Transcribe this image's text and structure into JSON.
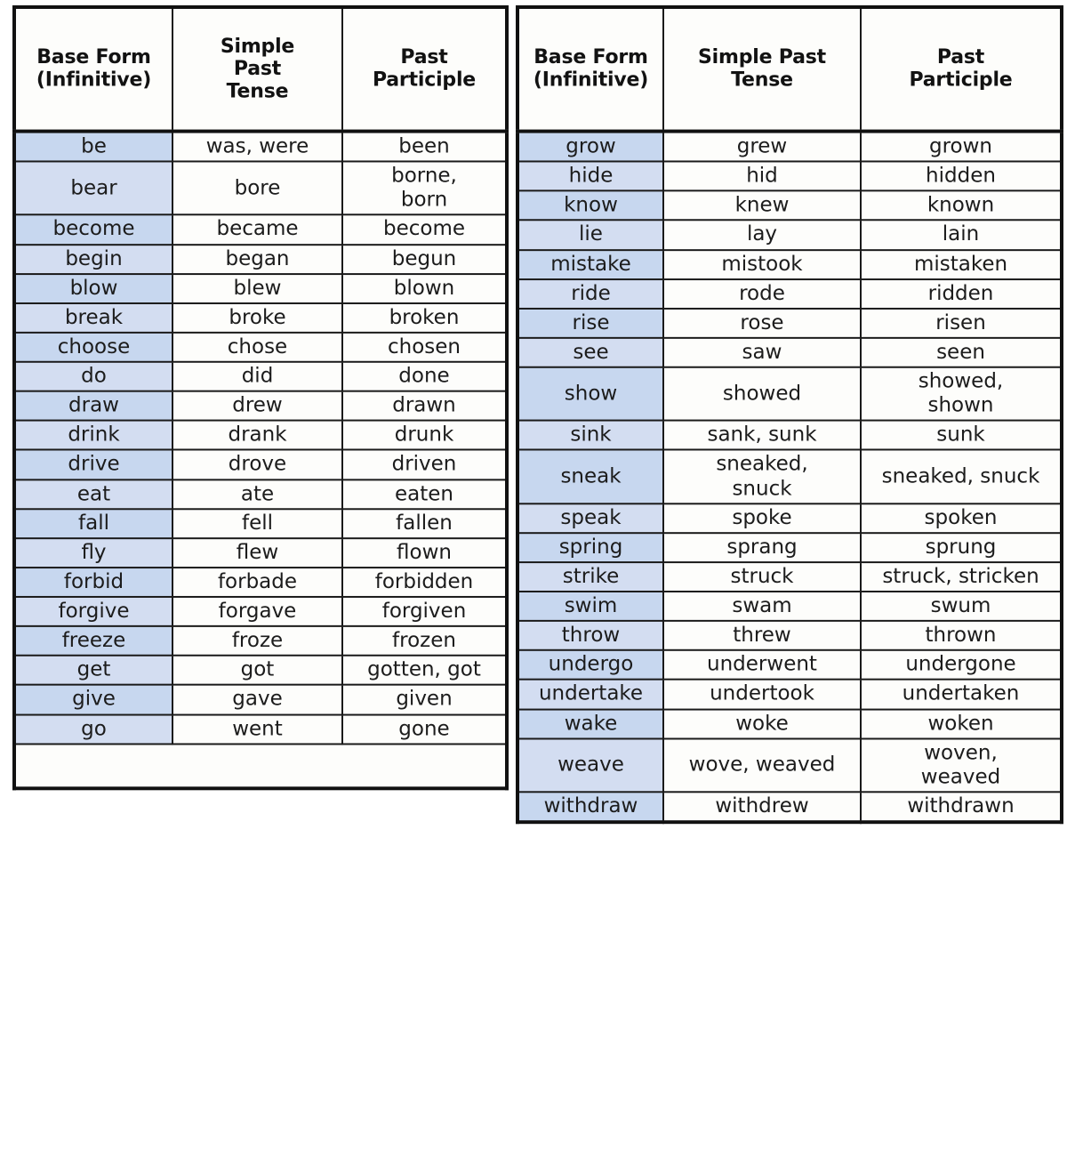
{
  "document": {
    "kind": "irregular-verbs-reference-table",
    "background_color": "#ffffff",
    "accent_color": "#c7d7ef",
    "border_color": "#111111",
    "text_color": "#1c1c1c"
  },
  "left_table": {
    "headers": {
      "base": "Base Form\n(Infinitive)",
      "base_line1": "Base Form",
      "base_line2": "(Infinitive)",
      "simple_past_line1": "Simple",
      "simple_past_line2": "Past",
      "simple_past_line3": "Tense",
      "past_participle_line1": "Past",
      "past_participle_line2": "Participle"
    },
    "rows": [
      {
        "base": "be",
        "past": "was, were",
        "participle": "been"
      },
      {
        "base": "bear",
        "past": "bore",
        "participle": "borne,\nborn",
        "participle_line1": "borne,",
        "participle_line2": "born"
      },
      {
        "base": "become",
        "past": "became",
        "participle": "become"
      },
      {
        "base": "begin",
        "past": "began",
        "participle": "begun"
      },
      {
        "base": "blow",
        "past": "blew",
        "participle": "blown"
      },
      {
        "base": "break",
        "past": "broke",
        "participle": "broken"
      },
      {
        "base": "choose",
        "past": "chose",
        "participle": "chosen"
      },
      {
        "base": "do",
        "past": "did",
        "participle": "done"
      },
      {
        "base": "draw",
        "past": "drew",
        "participle": "drawn"
      },
      {
        "base": "drink",
        "past": "drank",
        "participle": "drunk"
      },
      {
        "base": "drive",
        "past": "drove",
        "participle": "driven"
      },
      {
        "base": "eat",
        "past": "ate",
        "participle": "eaten"
      },
      {
        "base": "fall",
        "past": "fell",
        "participle": "fallen"
      },
      {
        "base": "fly",
        "past": "flew",
        "participle": "flown"
      },
      {
        "base": "forbid",
        "past": "forbade",
        "participle": "forbidden"
      },
      {
        "base": "forgive",
        "past": "forgave",
        "participle": "forgiven"
      },
      {
        "base": "freeze",
        "past": "froze",
        "participle": "frozen"
      },
      {
        "base": "get",
        "past": "got",
        "participle": "gotten, got"
      },
      {
        "base": "give",
        "past": "gave",
        "participle": "given"
      },
      {
        "base": "go",
        "past": "went",
        "participle": "gone"
      }
    ],
    "trailing_blank_row": true
  },
  "right_table": {
    "headers": {
      "base_line1": "Base Form",
      "base_line2": "(Infinitive)",
      "simple_past_line1": "Simple Past",
      "simple_past_line2": "Tense",
      "past_participle_line1": "Past",
      "past_participle_line2": "Participle"
    },
    "rows": [
      {
        "base": "grow",
        "past": "grew",
        "participle": "grown"
      },
      {
        "base": "hide",
        "past": "hid",
        "participle": "hidden"
      },
      {
        "base": "know",
        "past": "knew",
        "participle": "known"
      },
      {
        "base": "lie",
        "past": "lay",
        "participle": "lain"
      },
      {
        "base": "mistake",
        "past": "mistook",
        "participle": "mistaken"
      },
      {
        "base": "ride",
        "past": "rode",
        "participle": "ridden"
      },
      {
        "base": "rise",
        "past": "rose",
        "participle": "risen"
      },
      {
        "base": "see",
        "past": "saw",
        "participle": "seen"
      },
      {
        "base": "show",
        "past": "showed",
        "participle": "showed,\nshown",
        "participle_line1": "showed,",
        "participle_line2": "shown"
      },
      {
        "base": "sink",
        "past": "sank, sunk",
        "participle": "sunk"
      },
      {
        "base": "sneak",
        "past": "sneaked,\nsnuck",
        "past_line1": "sneaked,",
        "past_line2": "snuck",
        "participle": "sneaked, snuck"
      },
      {
        "base": "speak",
        "past": "spoke",
        "participle": "spoken"
      },
      {
        "base": "spring",
        "past": "sprang",
        "participle": "sprung"
      },
      {
        "base": "strike",
        "past": "struck",
        "participle": "struck, stricken"
      },
      {
        "base": "swim",
        "past": "swam",
        "participle": "swum"
      },
      {
        "base": "throw",
        "past": "threw",
        "participle": "thrown"
      },
      {
        "base": "undergo",
        "past": "underwent",
        "participle": "undergone"
      },
      {
        "base": "undertake",
        "past": "undertook",
        "participle": "undertaken"
      },
      {
        "base": "wake",
        "past": "woke",
        "participle": "woken"
      },
      {
        "base": "weave",
        "past": "wove, weaved",
        "participle": "woven,\nweaved",
        "participle_line1": "woven,",
        "participle_line2": "weaved"
      },
      {
        "base": "withdraw",
        "past": "withdrew",
        "participle": "withdrawn"
      }
    ],
    "trailing_blank_row": false
  }
}
